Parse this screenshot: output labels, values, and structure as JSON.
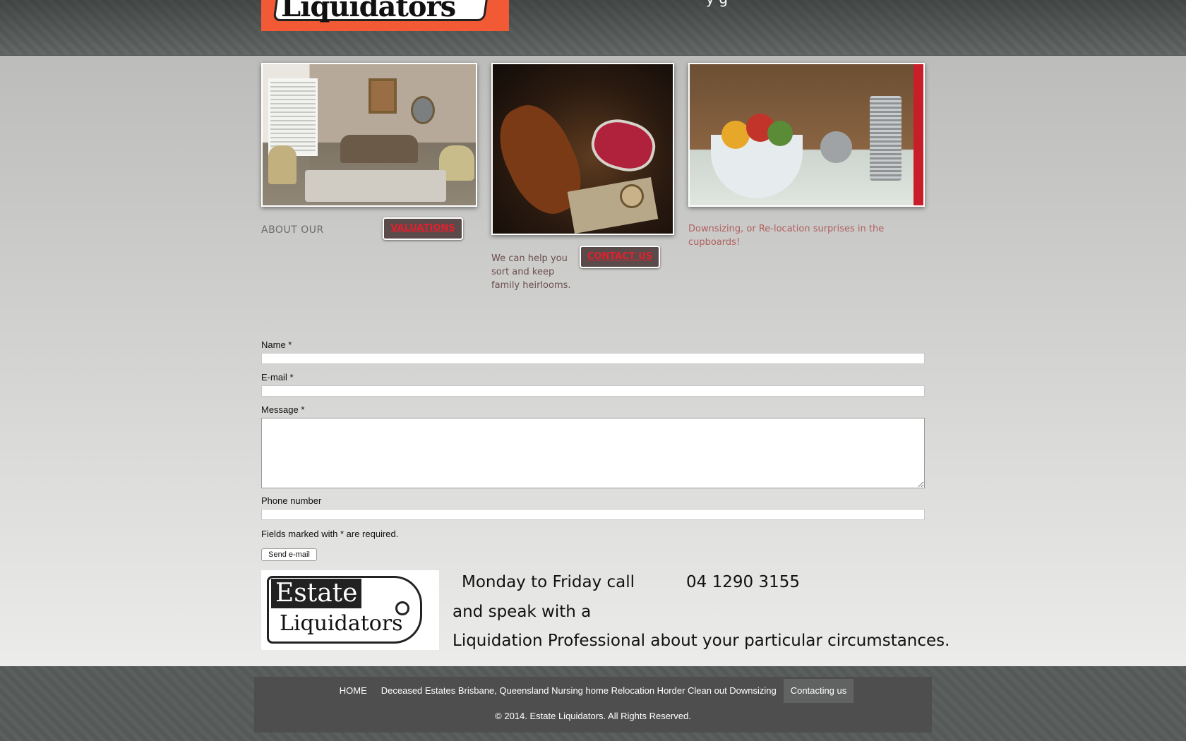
{
  "header": {
    "logo_text": "Liquidators",
    "tagline_fragment": "y      g"
  },
  "sections": {
    "about_label": "ABOUT OUR",
    "valuations_button": "VALUATIONS",
    "help_text": "We can help you sort and keep family heirlooms.",
    "contact_button": "CONTACT US",
    "downsize_text": "Downsizing, or Re-location  surprises in the cupboards!"
  },
  "form": {
    "name_label": "Name *",
    "name_value": "",
    "email_label": "E-mail *",
    "email_value": "",
    "message_label": "Message *",
    "message_value": "",
    "phone_label": "Phone number",
    "phone_value": "",
    "required_note": "Fields marked with * are required.",
    "send_label": "Send e-mail"
  },
  "promo": {
    "logo_word1": "Estate",
    "logo_word2": "Liquidators",
    "line1": "Monday to Friday call",
    "phone": "04 1290 3155",
    "line2": "and speak with a",
    "line3": "Liquidation Professional about your particular circumstances."
  },
  "footer": {
    "nav": [
      {
        "label": "HOME"
      },
      {
        "label": "Deceased Estates Brisbane, Queensland Nursing home Relocation Horder Clean out Downsizing"
      },
      {
        "label": "Contacting us"
      }
    ],
    "copyright": "© 2014. Estate Liquidators. All Rights Reserved."
  },
  "colors": {
    "accent_red": "#e2202d",
    "logo_orange": "#f15a35",
    "footer_bg": "#4d4e4d"
  }
}
